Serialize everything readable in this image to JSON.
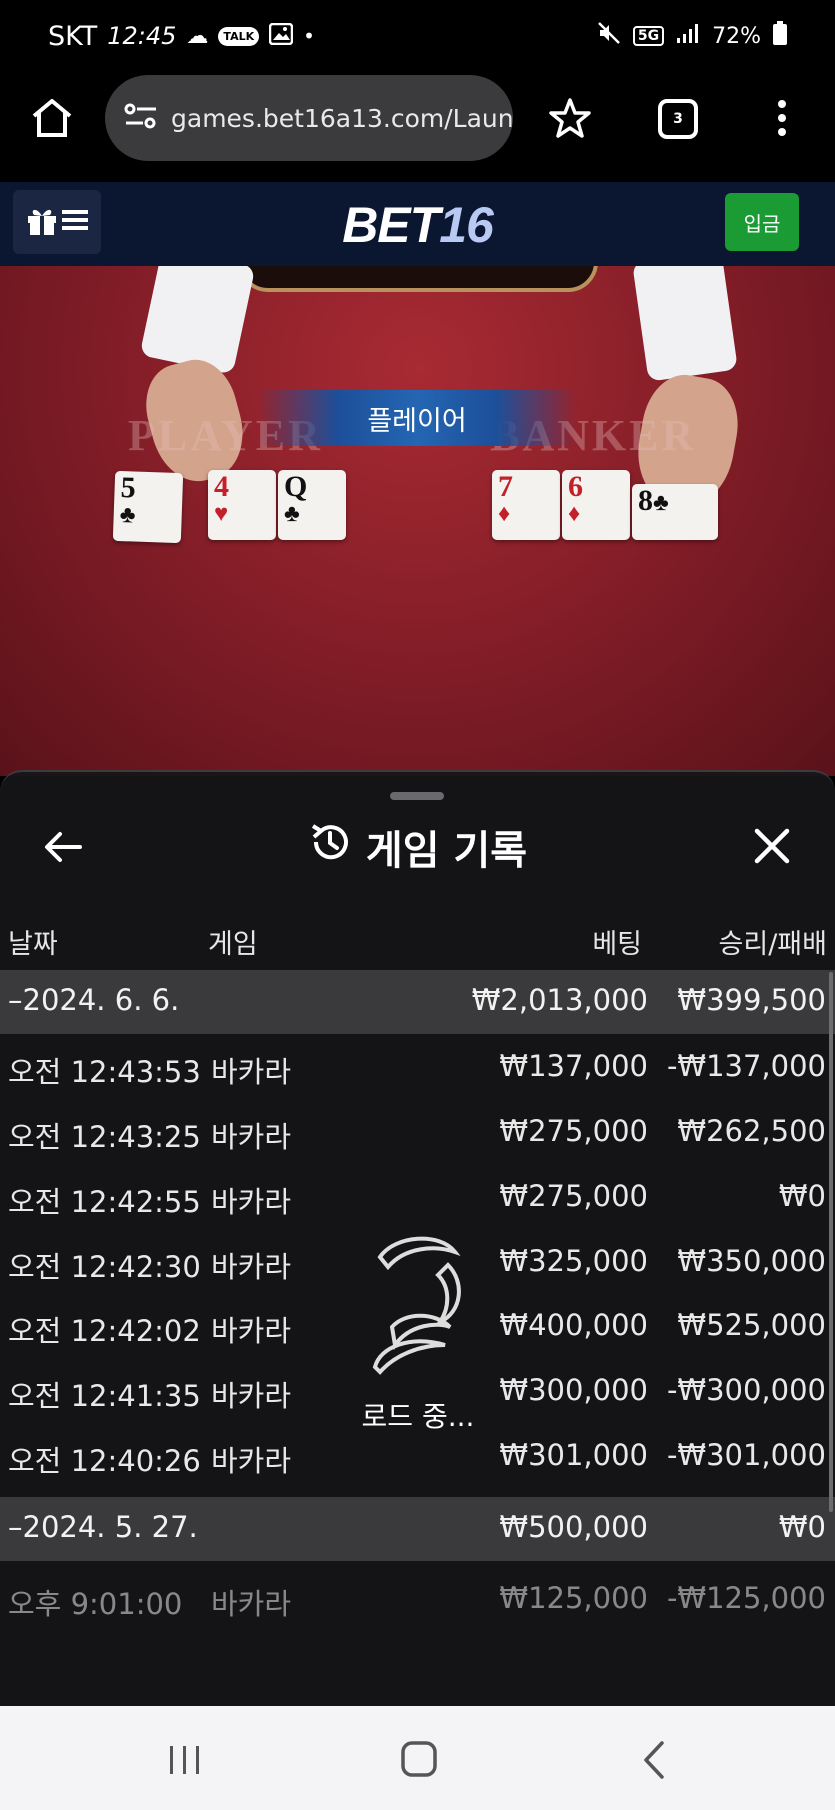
{
  "status_bar": {
    "carrier": "SKT",
    "time": "12:45",
    "talk_badge": "TALK",
    "network": "5G",
    "battery": "72%"
  },
  "browser": {
    "url": "games.bet16a13.com/Launc",
    "tab_count": "3"
  },
  "site": {
    "logo_text": "BET",
    "logo_number": "16",
    "deposit_label": "입금"
  },
  "game": {
    "banner": "플레이어",
    "player_label": "PLAYER",
    "banker_label": "BANKER",
    "player_cards": [
      {
        "rank": "5",
        "suit": "♣",
        "color": "black"
      },
      {
        "rank": "4",
        "suit": "♥",
        "color": "red"
      },
      {
        "rank": "Q",
        "suit": "♣",
        "color": "black"
      }
    ],
    "banker_cards": [
      {
        "rank": "7",
        "suit": "♦",
        "color": "red"
      },
      {
        "rank": "6",
        "suit": "♦",
        "color": "red"
      },
      {
        "rank": "8",
        "suit": "♣",
        "color": "black"
      }
    ]
  },
  "history": {
    "title": "게임 기록",
    "columns": {
      "date": "날짜",
      "game": "게임",
      "bet": "베팅",
      "result": "승리/패배"
    },
    "groups": [
      {
        "date": "–2024. 6. 6.",
        "bet_total": "₩2,013,000",
        "result_total": "₩399,500",
        "rows": [
          {
            "time": "오전 12:43:53",
            "game": "바카라",
            "bet": "₩137,000",
            "result": "-₩137,000"
          },
          {
            "time": "오전 12:43:25",
            "game": "바카라",
            "bet": "₩275,000",
            "result": "₩262,500"
          },
          {
            "time": "오전 12:42:55",
            "game": "바카라",
            "bet": "₩275,000",
            "result": "₩0"
          },
          {
            "time": "오전 12:42:30",
            "game": "바카라",
            "bet": "₩325,000",
            "result": "₩350,000"
          },
          {
            "time": "오전 12:42:02",
            "game": "바카라",
            "bet": "₩400,000",
            "result": "₩525,000"
          },
          {
            "time": "오전 12:41:35",
            "game": "바카라",
            "bet": "₩300,000",
            "result": "-₩300,000"
          },
          {
            "time": "오전 12:40:26",
            "game": "바카라",
            "bet": "₩301,000",
            "result": "-₩301,000"
          }
        ]
      },
      {
        "date": "–2024. 5. 27.",
        "bet_total": "₩500,000",
        "result_total": "₩0",
        "rows": [
          {
            "time": "오후 9:01:00",
            "game": "바카라",
            "bet": "₩125,000",
            "result": "-₩125,000"
          }
        ]
      }
    ],
    "loading_text": "로드 중..."
  }
}
